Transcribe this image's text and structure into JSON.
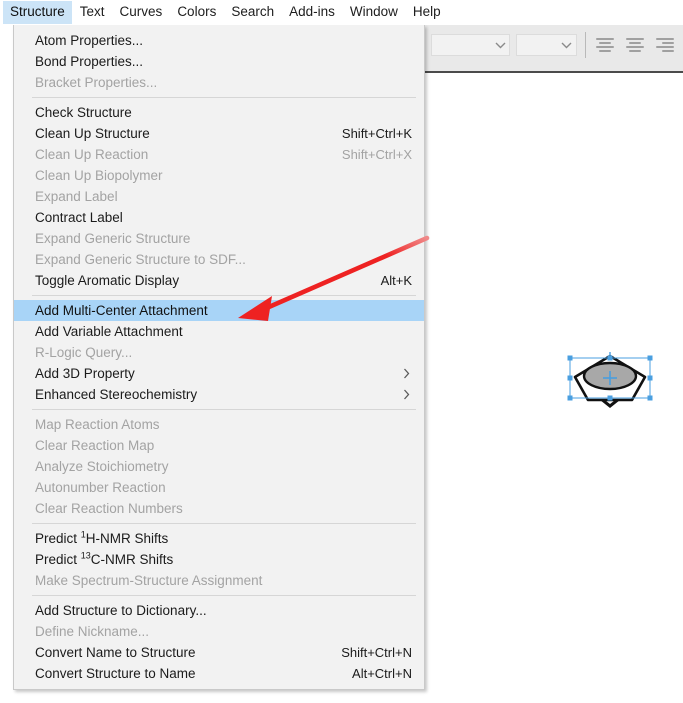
{
  "menubar": {
    "items": [
      {
        "label": "Structure",
        "active": true
      },
      {
        "label": "Text",
        "active": false
      },
      {
        "label": "Curves",
        "active": false
      },
      {
        "label": "Colors",
        "active": false
      },
      {
        "label": "Search",
        "active": false
      },
      {
        "label": "Add-ins",
        "active": false
      },
      {
        "label": "Window",
        "active": false
      },
      {
        "label": "Help",
        "active": false
      }
    ]
  },
  "toolbar": {
    "font_combo_value": "",
    "size_combo_value": "",
    "align_left_label": "Align Left",
    "align_center_label": "Align Center",
    "align_right_label": "Align Right"
  },
  "menu": {
    "title": "Structure",
    "groups": [
      {
        "items": [
          {
            "label": "Atom Properties...",
            "accel": "",
            "disabled": false,
            "selected": false,
            "submenu": false
          },
          {
            "label": "Bond Properties...",
            "accel": "",
            "disabled": false,
            "selected": false,
            "submenu": false
          },
          {
            "label": "Bracket Properties...",
            "accel": "",
            "disabled": true,
            "selected": false,
            "submenu": false
          }
        ]
      },
      {
        "items": [
          {
            "label": "Check Structure",
            "accel": "",
            "disabled": false,
            "selected": false,
            "submenu": false
          },
          {
            "label": "Clean Up Structure",
            "accel": "Shift+Ctrl+K",
            "disabled": false,
            "selected": false,
            "submenu": false
          },
          {
            "label": "Clean Up Reaction",
            "accel": "Shift+Ctrl+X",
            "disabled": true,
            "selected": false,
            "submenu": false
          },
          {
            "label": "Clean Up Biopolymer",
            "accel": "",
            "disabled": true,
            "selected": false,
            "submenu": false
          },
          {
            "label": "Expand Label",
            "accel": "",
            "disabled": true,
            "selected": false,
            "submenu": false
          },
          {
            "label": "Contract Label",
            "accel": "",
            "disabled": false,
            "selected": false,
            "submenu": false
          },
          {
            "label": "Expand Generic Structure",
            "accel": "",
            "disabled": true,
            "selected": false,
            "submenu": false
          },
          {
            "label": "Expand Generic Structure to SDF...",
            "accel": "",
            "disabled": true,
            "selected": false,
            "submenu": false
          },
          {
            "label": "Toggle Aromatic Display",
            "accel": "Alt+K",
            "disabled": false,
            "selected": false,
            "submenu": false
          }
        ]
      },
      {
        "items": [
          {
            "label": "Add Multi-Center Attachment",
            "accel": "",
            "disabled": false,
            "selected": true,
            "submenu": false
          },
          {
            "label": "Add Variable Attachment",
            "accel": "",
            "disabled": false,
            "selected": false,
            "submenu": false
          },
          {
            "label": "R-Logic Query...",
            "accel": "",
            "disabled": true,
            "selected": false,
            "submenu": false
          },
          {
            "label": "Add 3D Property",
            "accel": "",
            "disabled": false,
            "selected": false,
            "submenu": true
          },
          {
            "label": "Enhanced Stereochemistry",
            "accel": "",
            "disabled": false,
            "selected": false,
            "submenu": true
          }
        ]
      },
      {
        "items": [
          {
            "label": "Map Reaction Atoms",
            "accel": "",
            "disabled": true,
            "selected": false,
            "submenu": false
          },
          {
            "label": "Clear Reaction Map",
            "accel": "",
            "disabled": true,
            "selected": false,
            "submenu": false
          },
          {
            "label": "Analyze Stoichiometry",
            "accel": "",
            "disabled": true,
            "selected": false,
            "submenu": false
          },
          {
            "label": "Autonumber Reaction",
            "accel": "",
            "disabled": true,
            "selected": false,
            "submenu": false
          },
          {
            "label": "Clear Reaction Numbers",
            "accel": "",
            "disabled": true,
            "selected": false,
            "submenu": false
          }
        ]
      },
      {
        "items": [
          {
            "label": "Predict ",
            "sup": "1",
            "label_after": "H-NMR Shifts",
            "accel": "",
            "disabled": false,
            "selected": false,
            "submenu": false
          },
          {
            "label": "Predict ",
            "sup": "13",
            "label_after": "C-NMR Shifts",
            "accel": "",
            "disabled": false,
            "selected": false,
            "submenu": false
          },
          {
            "label": "Make Spectrum-Structure Assignment",
            "accel": "",
            "disabled": true,
            "selected": false,
            "submenu": false
          }
        ]
      },
      {
        "items": [
          {
            "label": "Add Structure to Dictionary...",
            "accel": "",
            "disabled": false,
            "selected": false,
            "submenu": false
          },
          {
            "label": "Define Nickname...",
            "accel": "",
            "disabled": true,
            "selected": false,
            "submenu": false
          },
          {
            "label": "Convert Name to Structure",
            "accel": "Shift+Ctrl+N",
            "disabled": false,
            "selected": false,
            "submenu": false
          },
          {
            "label": "Convert Structure to Name",
            "accel": "Alt+Ctrl+N",
            "disabled": false,
            "selected": false,
            "submenu": false
          }
        ]
      }
    ]
  },
  "annotation": {
    "arrow_color": "#ee2222",
    "arrow_target": "Add Multi-Center Attachment"
  },
  "canvas": {
    "object_name": "cyclopentane-3d-shape",
    "object_selected": true,
    "selection_handle_color": "#4a9fe0"
  },
  "colors": {
    "menu_background": "#f2f2f2",
    "menu_highlight": "#a8d4f7",
    "menubar_highlight": "#cce4f7",
    "disabled_text": "#a3a3a3",
    "text": "#1b1b1b",
    "toolbar_background": "#e9e9e9"
  }
}
